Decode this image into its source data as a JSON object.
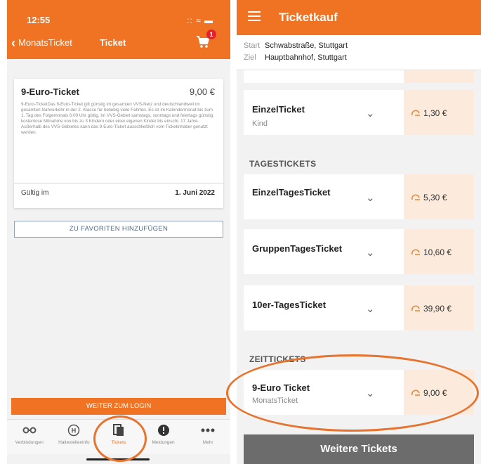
{
  "left": {
    "status_time": "12:55",
    "status_icons": ":: ≈ ▬",
    "back_label": "MonatsTicket",
    "title": "Ticket",
    "cart_count": "1",
    "ticket": {
      "name": "9-Euro-Ticket",
      "price": "9,00 €",
      "description": "9-Euro-TicketDas 9-Euro-Ticket gilt günstig im gesamten VVS-Netz und deutschlandweit im gesamten Nahverkehr in der 2. Klasse für beliebig viele Fahrten. Es ist im Kalendermonat bis zum 1. Tag des Folgemonats 6:00 Uhr gültig. Im VVS-Gebiet samstags, sonntags und feiertags günstig kostenlose Mitnahme von bis zu 3 Kindern oder einer eigenen Kinder bis einschl. 17 Jahre. Außerhalb des VVS-Gebietes kann das 9-Euro-Ticket ausschließlich vom Ticketinhaber genutzt werden.",
      "valid_label": "Gültig im",
      "valid_value": "1. Juni 2022"
    },
    "favorite_button": "ZU FAVORITEN HINZUFÜGEN",
    "login_button": "WEITER ZUM LOGIN",
    "tabs": [
      {
        "label": "Verbindungen",
        "icon": "route-icon"
      },
      {
        "label": "Haltestelleninfo",
        "icon": "stop-icon"
      },
      {
        "label": "Tickets",
        "icon": "tickets-icon"
      },
      {
        "label": "Meldungen",
        "icon": "alert-icon"
      },
      {
        "label": "Mehr",
        "icon": "more-icon"
      }
    ],
    "accent": "#ef7322"
  },
  "right": {
    "title": "Ticketkauf",
    "start_label": "Start",
    "start_value": "Schwabstraße, Stuttgart",
    "end_label": "Ziel",
    "end_value": "Hauptbahnhof, Stuttgart",
    "tickets": [
      {
        "name": "EinzelTicket",
        "sub": "Kind",
        "price": "1,30 €"
      },
      {
        "name": "EinzelTagesTicket",
        "sub": "",
        "price": "5,30 €"
      },
      {
        "name": "GruppenTagesTicket",
        "sub": "",
        "price": "10,60 €"
      },
      {
        "name": "10er-TagesTicket",
        "sub": "",
        "price": "39,90 €"
      },
      {
        "name": "9-Euro Ticket",
        "sub": "MonatsTicket",
        "price": "9,00 €"
      }
    ],
    "section_day": "TAGESTICKETS",
    "section_time": "ZEITTICKETS",
    "more_button": "Weitere Tickets",
    "price_bg": "#fcebdc"
  }
}
